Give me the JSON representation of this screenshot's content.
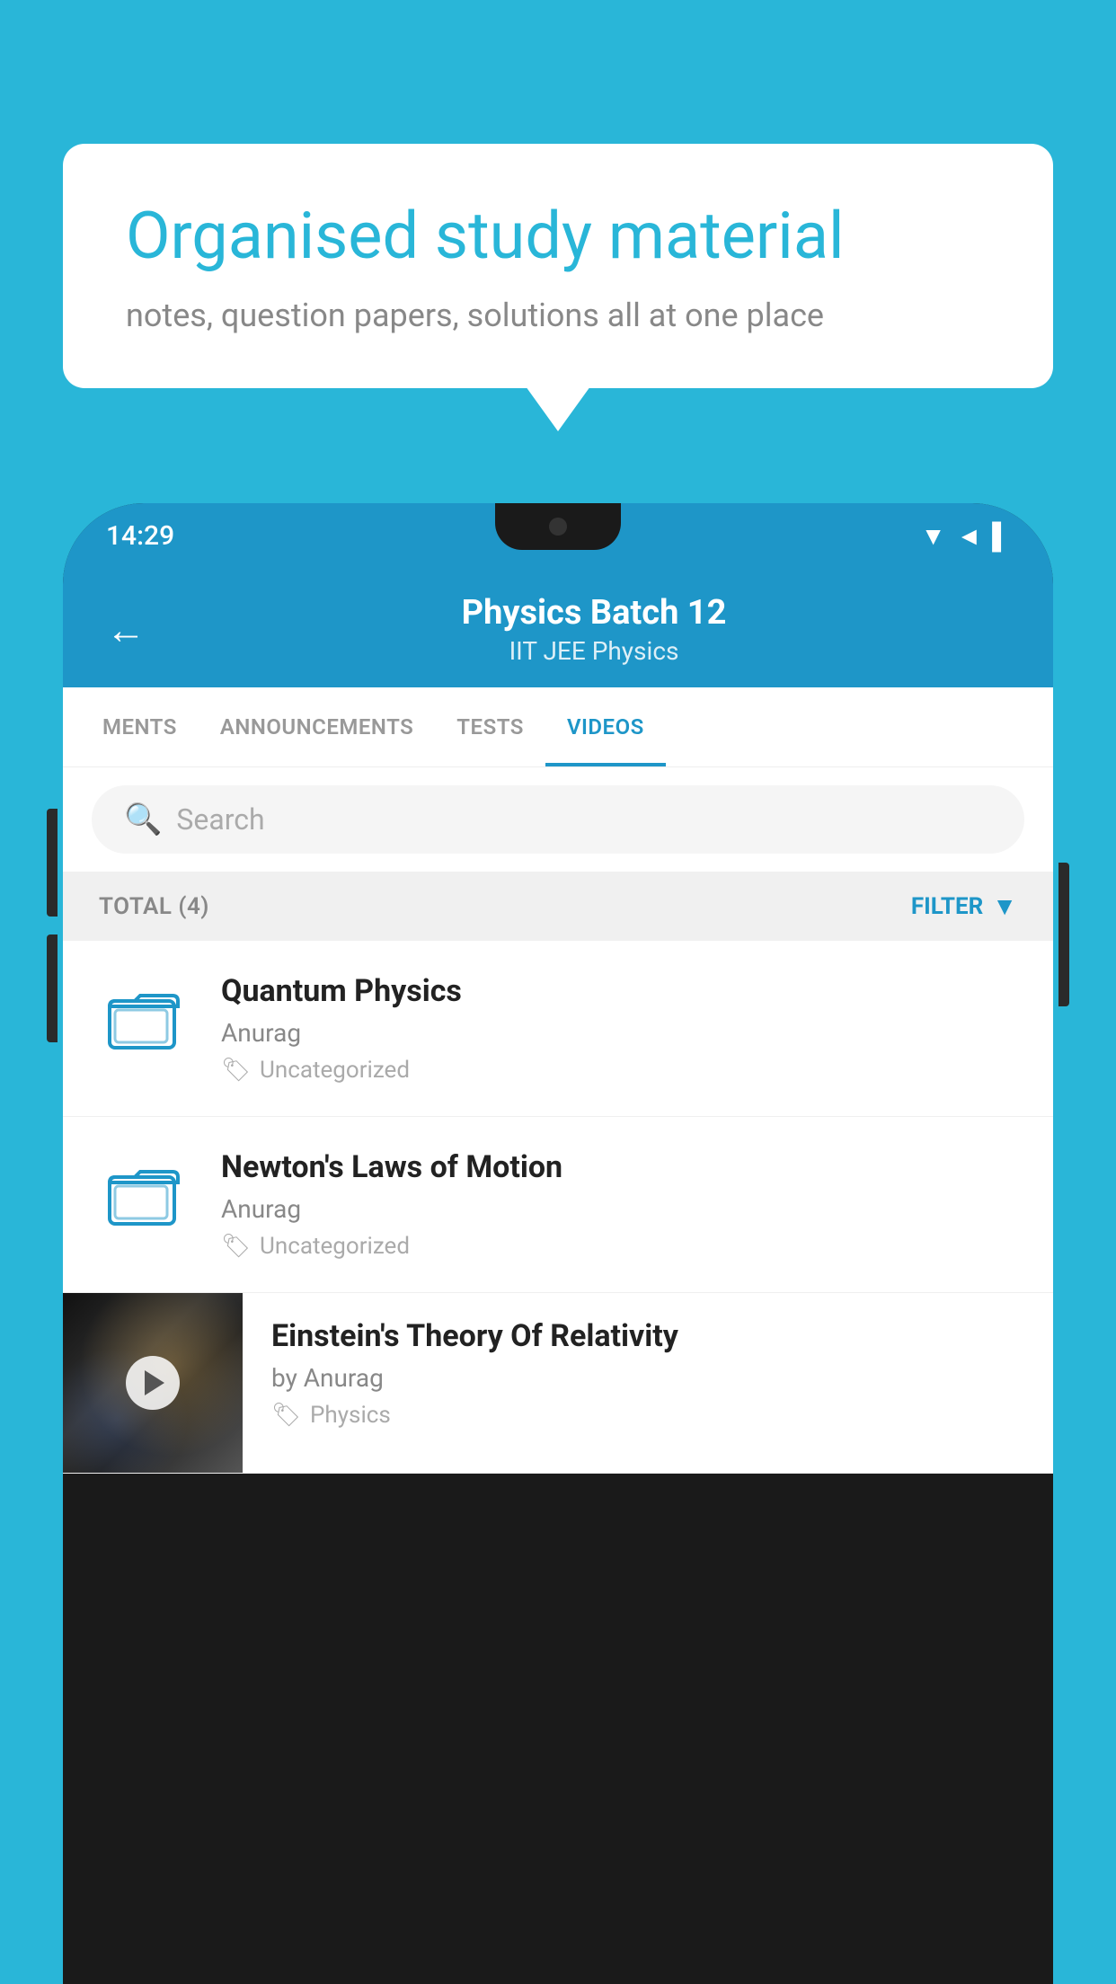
{
  "background_color": "#29b6d8",
  "speech_bubble": {
    "heading": "Organised study material",
    "subtext": "notes, question papers, solutions all at one place"
  },
  "phone": {
    "status_bar": {
      "time": "14:29",
      "icons": [
        "wifi",
        "signal",
        "battery"
      ]
    },
    "app_header": {
      "back_label": "←",
      "title": "Physics Batch 12",
      "subtitle": "IIT JEE   Physics"
    },
    "tabs": [
      {
        "label": "MENTS",
        "active": false
      },
      {
        "label": "ANNOUNCEMENTS",
        "active": false
      },
      {
        "label": "TESTS",
        "active": false
      },
      {
        "label": "VIDEOS",
        "active": true
      }
    ],
    "search": {
      "placeholder": "Search",
      "icon": "🔍"
    },
    "filter_bar": {
      "total_label": "TOTAL (4)",
      "filter_label": "FILTER"
    },
    "items": [
      {
        "type": "folder",
        "title": "Quantum Physics",
        "author": "Anurag",
        "tag": "Uncategorized"
      },
      {
        "type": "folder",
        "title": "Newton's Laws of Motion",
        "author": "Anurag",
        "tag": "Uncategorized"
      },
      {
        "type": "video",
        "title": "Einstein's Theory Of Relativity",
        "author": "by Anurag",
        "tag": "Physics"
      }
    ]
  }
}
